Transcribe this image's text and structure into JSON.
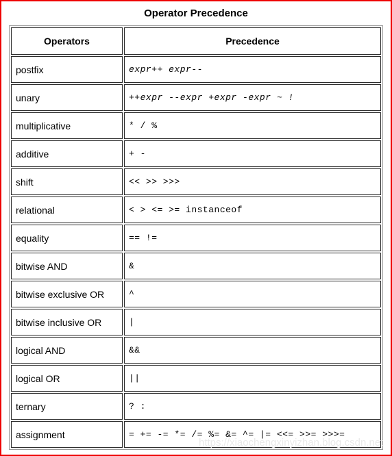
{
  "title": "Operator Precedence",
  "table": {
    "headers": [
      "Operators",
      "Precedence"
    ],
    "rows": [
      {
        "operators": "postfix",
        "precedence": "expr++ expr--",
        "italic": true
      },
      {
        "operators": "unary",
        "precedence": "++expr --expr +expr -expr ~ !",
        "italic": true
      },
      {
        "operators": "multiplicative",
        "precedence": "* / %",
        "italic": false
      },
      {
        "operators": "additive",
        "precedence": "+ -",
        "italic": false
      },
      {
        "operators": "shift",
        "precedence": "<< >> >>>",
        "italic": false
      },
      {
        "operators": "relational",
        "precedence": "< > <= >= instanceof",
        "italic": false
      },
      {
        "operators": "equality",
        "precedence": "== !=",
        "italic": false
      },
      {
        "operators": "bitwise AND",
        "precedence": "&",
        "italic": false
      },
      {
        "operators": "bitwise exclusive OR",
        "precedence": "^",
        "italic": false
      },
      {
        "operators": "bitwise inclusive OR",
        "precedence": "|",
        "italic": false
      },
      {
        "operators": "logical AND",
        "precedence": "&&",
        "italic": false
      },
      {
        "operators": "logical OR",
        "precedence": "||",
        "italic": false
      },
      {
        "operators": "ternary",
        "precedence": "? :",
        "italic": false
      },
      {
        "operators": "assignment",
        "precedence": "= += -= *= /= %= &= ^= |= <<= >>= >>>=",
        "italic": false
      }
    ]
  },
  "watermark": "https://xiaochengxinyizhan.blog.csdn.net",
  "colors": {
    "page_border": "#ee0000",
    "table_outer_border": "#9a9a9a",
    "cell_border": "#2b2b2b",
    "text": "#000000",
    "watermark": "#e9e9e9"
  }
}
